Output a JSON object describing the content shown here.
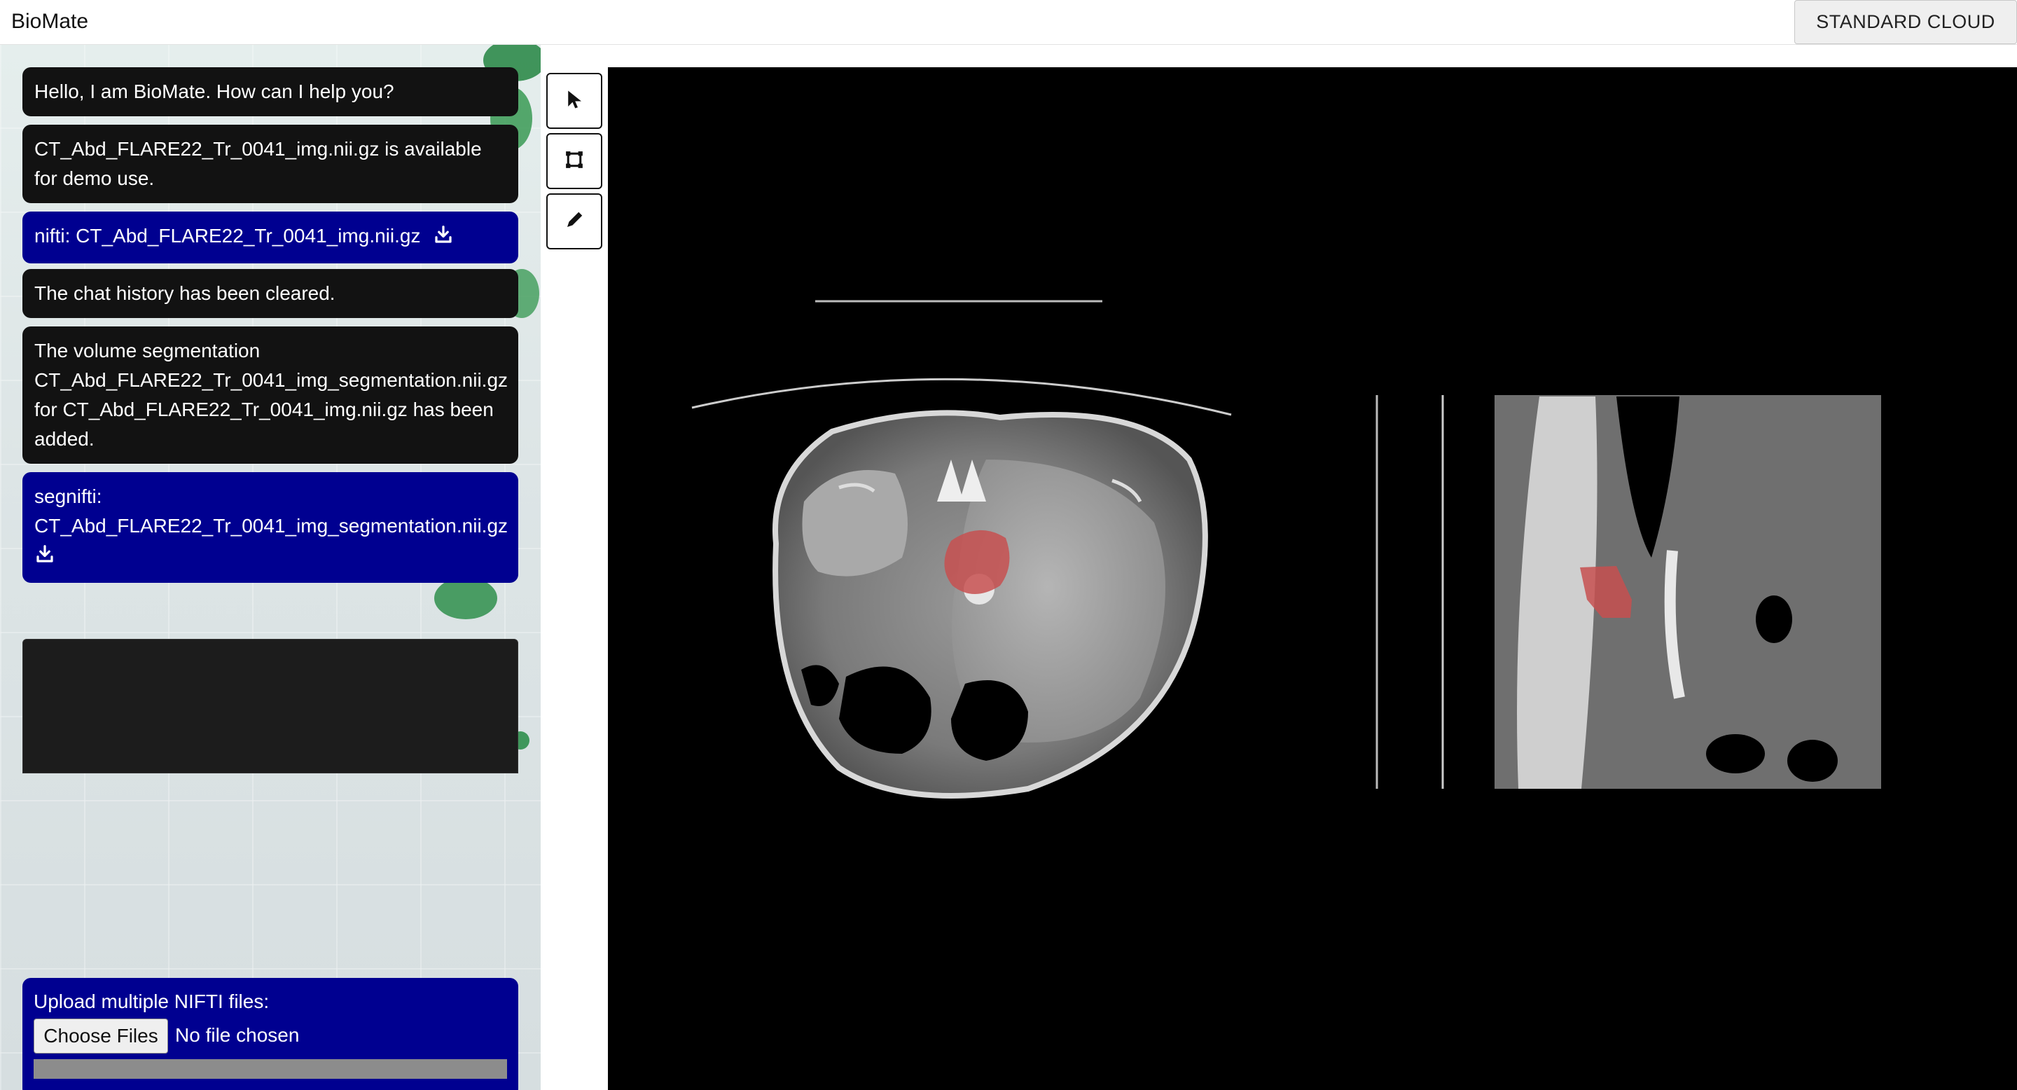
{
  "app": {
    "title": "BioMate"
  },
  "header": {
    "cloud_button": "STANDARD CLOUD"
  },
  "chat": {
    "messages": [
      {
        "kind": "text",
        "text": "Hello, I am BioMate. How can I help you?"
      },
      {
        "kind": "text",
        "lines": [
          "CT_Abd_FLARE22_Tr_0041_img.nii.gz is available",
          "for demo use."
        ]
      },
      {
        "kind": "file",
        "text": "nifti: CT_Abd_FLARE22_Tr_0041_img.nii.gz",
        "icon": "download-icon"
      },
      {
        "kind": "text",
        "text": "The chat history has been cleared."
      },
      {
        "kind": "text",
        "lines": [
          "The volume segmentation",
          "CT_Abd_FLARE22_Tr_0041_img_segmentation.nii.gz",
          "for CT_Abd_FLARE22_Tr_0041_img.nii.gz has been",
          "added."
        ]
      },
      {
        "kind": "file",
        "lines": [
          "segnifti:",
          "CT_Abd_FLARE22_Tr_0041_img_segmentation.nii.gz"
        ],
        "icon": "download-icon"
      }
    ],
    "input": {
      "value": "",
      "placeholder": ""
    }
  },
  "upload": {
    "label": "Upload multiple NIFTI files:",
    "choose_button": "Choose Files",
    "status": "No file chosen",
    "progress": 0
  },
  "tools": [
    {
      "name": "pointer-tool",
      "icon": "cursor-arrow-icon"
    },
    {
      "name": "crop-tool",
      "icon": "crop-frame-icon"
    },
    {
      "name": "draw-tool",
      "icon": "pencil-icon"
    }
  ],
  "colors": {
    "message_dark": "#121212",
    "message_blue": "#000090",
    "segmentation_overlay": "#c75050",
    "viewer_background": "#000000"
  }
}
